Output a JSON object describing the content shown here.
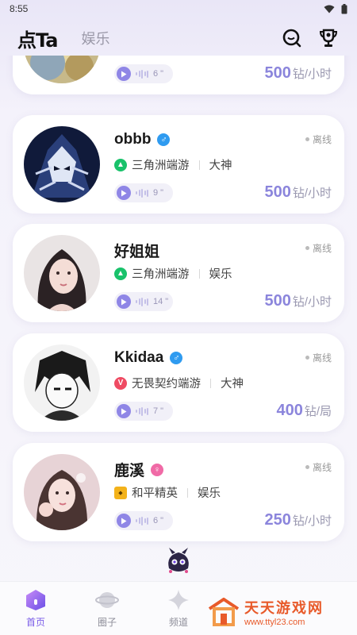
{
  "status_bar": {
    "time": "8:55"
  },
  "header": {
    "logo": "点Ta",
    "tab_entertainment": "娱乐"
  },
  "cards": [
    {
      "name": "",
      "voice_duration": "6 \"",
      "price": "500",
      "unit": "钻/小时"
    },
    {
      "name": "obbb",
      "gender": "male",
      "gender_symbol": "♂",
      "status": "离线",
      "game": "三角洲端游",
      "game_icon": "delta",
      "role": "大神",
      "voice_duration": "9 \"",
      "price": "500",
      "unit": "钻/小时"
    },
    {
      "name": "好姐姐",
      "gender": "none",
      "gender_symbol": "",
      "status": "离线",
      "game": "三角洲端游",
      "game_icon": "delta",
      "role": "娱乐",
      "voice_duration": "14 \"",
      "price": "500",
      "unit": "钻/小时"
    },
    {
      "name": "Kkidaa",
      "gender": "male",
      "gender_symbol": "♂",
      "status": "离线",
      "game": "无畏契约端游",
      "game_icon": "fearless",
      "role": "大神",
      "voice_duration": "7 \"",
      "price": "400",
      "unit": "钻/局"
    },
    {
      "name": "鹿溪",
      "gender": "female",
      "gender_symbol": "♀",
      "status": "离线",
      "game": "和平精英",
      "game_icon": "peace",
      "role": "娱乐",
      "voice_duration": "6 \"",
      "price": "250",
      "unit": "钻/小时"
    }
  ],
  "tabbar": {
    "home": "首页",
    "circle": "圈子",
    "channel": "频道"
  },
  "watermark": {
    "title": "天天游戏网",
    "url": "www.ttyl23.com"
  }
}
